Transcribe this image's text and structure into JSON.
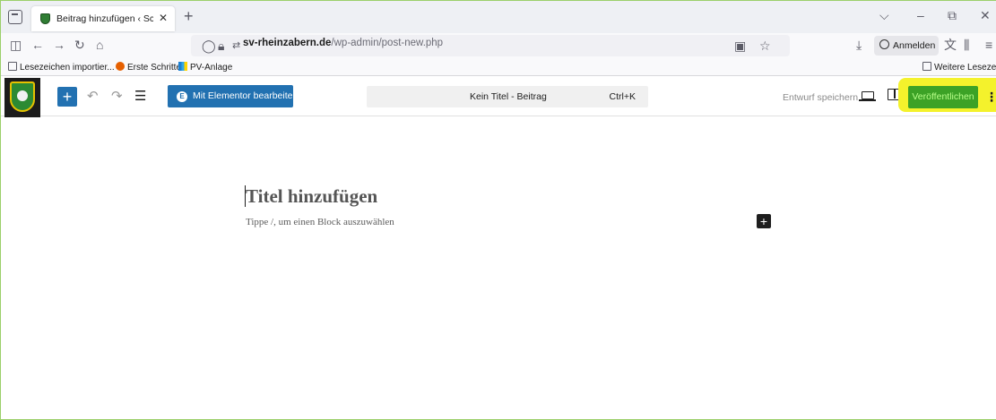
{
  "browser": {
    "tab": {
      "title": "Beitrag hinzufügen ‹ Schützenv"
    },
    "url": {
      "host": "sv-rheinzabern.de",
      "path": "/wp-admin/post-new.php"
    },
    "sign_in_label": "Anmelden",
    "bookmarks": [
      {
        "label": "Lesezeichen importier..."
      },
      {
        "label": "Erste Schritte"
      },
      {
        "label": "PV-Anlage"
      }
    ],
    "other_bookmarks": "Weitere Lesezeichen"
  },
  "editor": {
    "elementor_label": "Mit Elementor bearbeiten",
    "document_title": "Kein Titel - Beitrag",
    "shortcut": "Ctrl+K",
    "save_draft_label": "Entwurf speichern",
    "publish_label": "Veröffentlichen",
    "title_placeholder": "Titel hinzufügen",
    "block_placeholder": "Tippe /, um einen Block auszuwählen"
  },
  "colors": {
    "wp_blue": "#2271b1",
    "publish_green": "#3ca226",
    "highlight_yellow": "#f4f22c"
  }
}
